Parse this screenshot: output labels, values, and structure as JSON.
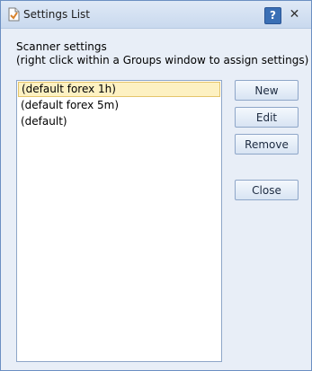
{
  "window": {
    "title": "Settings List",
    "help_label": "?",
    "close_label": "✕"
  },
  "main": {
    "heading": "Scanner settings",
    "hint": "(right click within a Groups window to assign settings)",
    "list_items": [
      {
        "label": "(default forex 1h)",
        "selected": true
      },
      {
        "label": "(default forex 5m)",
        "selected": false
      },
      {
        "label": "(default)",
        "selected": false
      }
    ]
  },
  "buttons": {
    "new": "New",
    "edit": "Edit",
    "remove": "Remove",
    "close": "Close"
  },
  "colors": {
    "selection_bg": "#fdf1c2",
    "selection_border": "#e4c56b",
    "accent": "#3a6fb5"
  }
}
